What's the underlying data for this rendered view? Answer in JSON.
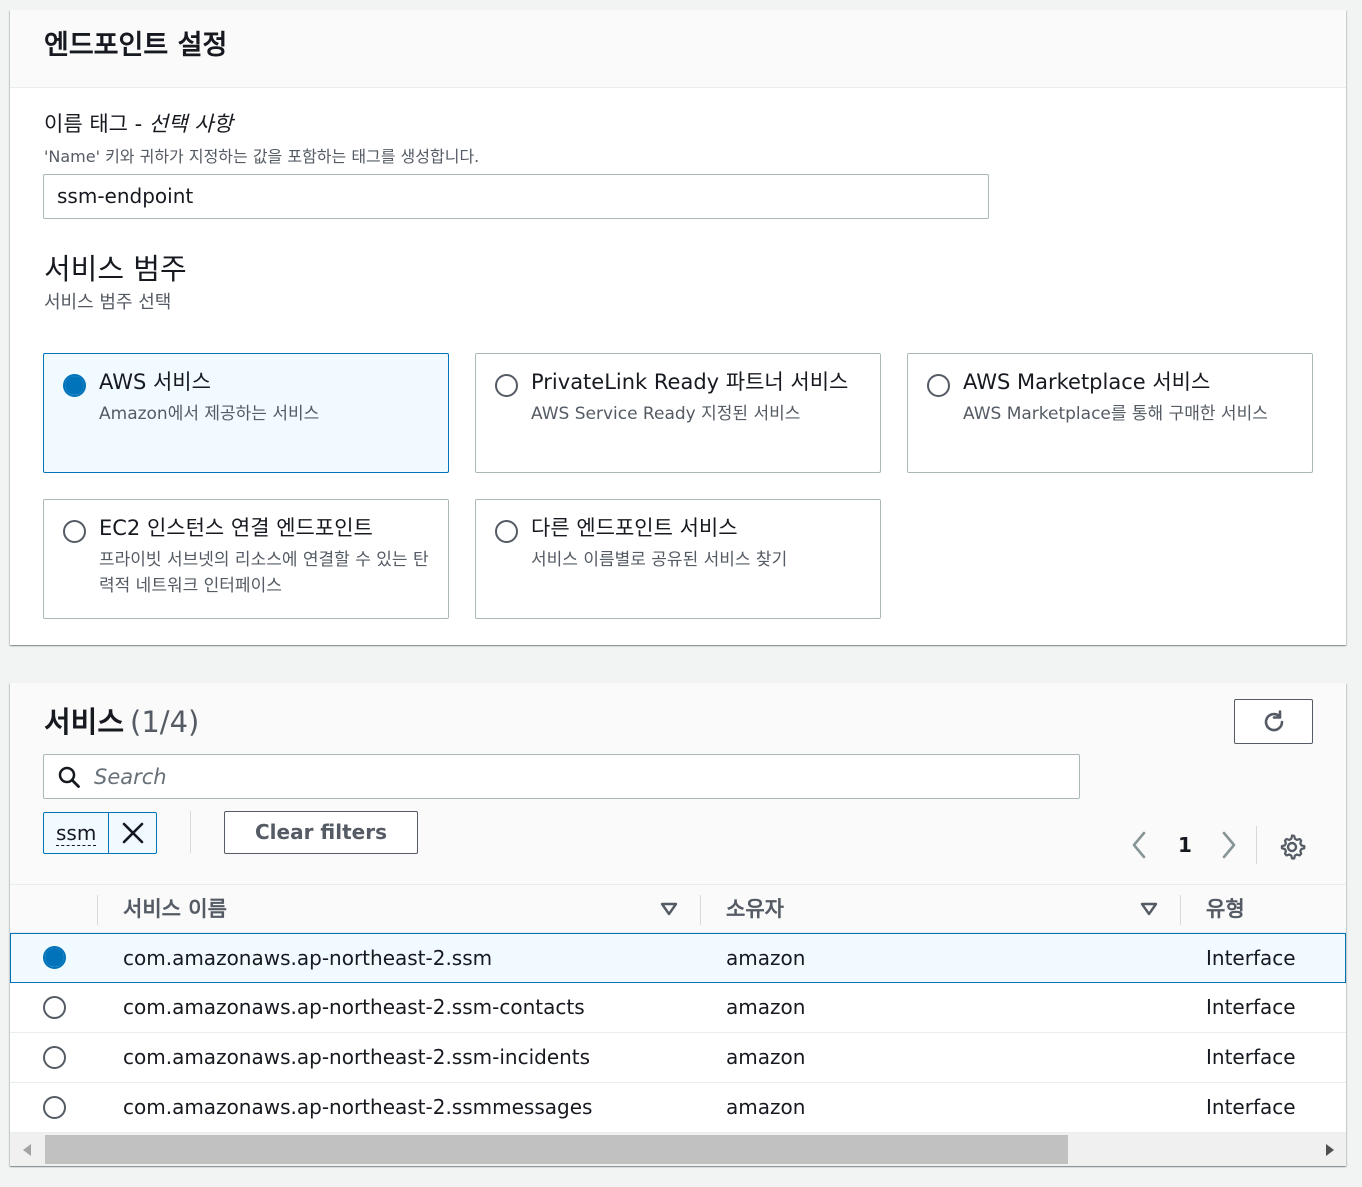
{
  "endpoint_settings": {
    "title": "엔드포인트 설정",
    "name_tag_label": "이름 태그 - ",
    "name_tag_optional": "선택 사항",
    "name_tag_desc": "'Name' 키와 귀하가 지정하는 값을 포함하는 태그를 생성합니다.",
    "name_tag_value": "ssm-endpoint",
    "category_title": "서비스 범주",
    "category_desc": "서비스 범주 선택",
    "tiles": [
      {
        "title": "AWS 서비스",
        "desc": "Amazon에서 제공하는 서비스",
        "selected": true
      },
      {
        "title": "PrivateLink Ready 파트너 서비스",
        "desc": "AWS Service Ready 지정된 서비스",
        "selected": false
      },
      {
        "title": "AWS Marketplace 서비스",
        "desc": "AWS Marketplace를 통해 구매한 서비스",
        "selected": false
      },
      {
        "title": "EC2 인스턴스 연결 엔드포인트",
        "desc": "프라이빗 서브넷의 리소스에 연결할 수 있는 탄력적 네트워크 인터페이스",
        "selected": false
      },
      {
        "title": "다른 엔드포인트 서비스",
        "desc": "서비스 이름별로 공유된 서비스 찾기",
        "selected": false
      }
    ]
  },
  "services": {
    "title": "서비스",
    "count": "(1/4)",
    "search_placeholder": "Search",
    "filter_token": "ssm",
    "clear_filters": "Clear filters",
    "page": "1",
    "columns": [
      "서비스 이름",
      "소유자",
      "유형"
    ],
    "rows": [
      {
        "name": "com.amazonaws.ap-northeast-2.ssm",
        "owner": "amazon",
        "type": "Interface",
        "selected": true
      },
      {
        "name": "com.amazonaws.ap-northeast-2.ssm-contacts",
        "owner": "amazon",
        "type": "Interface",
        "selected": false
      },
      {
        "name": "com.amazonaws.ap-northeast-2.ssm-incidents",
        "owner": "amazon",
        "type": "Interface",
        "selected": false
      },
      {
        "name": "com.amazonaws.ap-northeast-2.ssmmessages",
        "owner": "amazon",
        "type": "Interface",
        "selected": false
      }
    ]
  },
  "colors": {
    "accent": "#0073bb",
    "selected_bg": "#f1faff",
    "muted_text": "#545b64"
  },
  "icons": [
    "refresh-icon",
    "search-icon",
    "close-icon",
    "chevron-left-icon",
    "chevron-right-icon",
    "gear-icon",
    "sort-down-icon"
  ]
}
